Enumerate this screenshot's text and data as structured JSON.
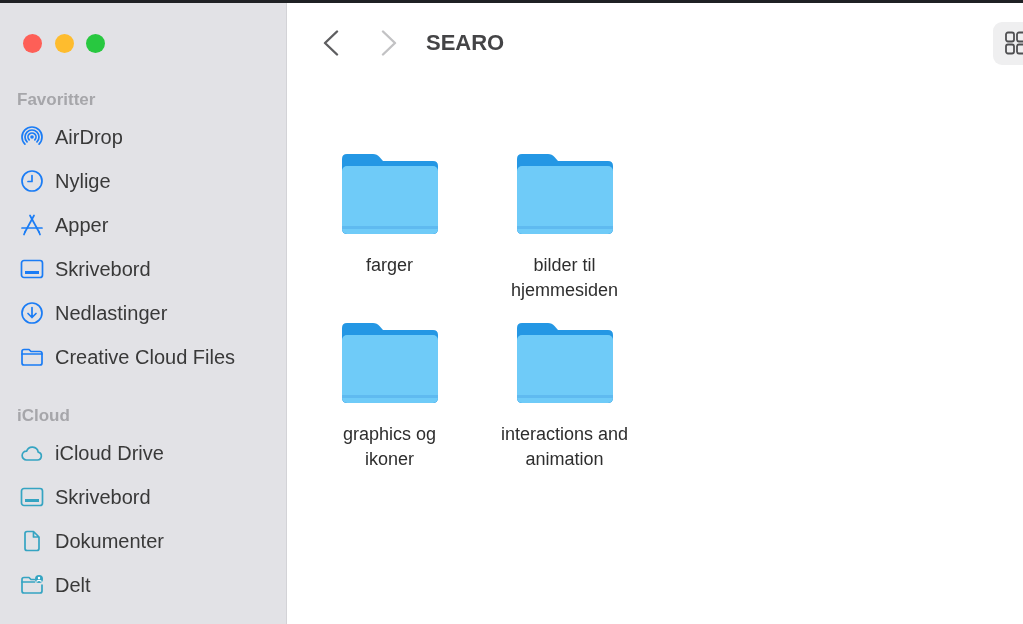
{
  "sidebar": {
    "sections": [
      {
        "title": "Favoritter",
        "items": [
          {
            "label": "AirDrop",
            "kind": "airdrop",
            "selected": false
          },
          {
            "label": "Nylige",
            "kind": "clock",
            "selected": false
          },
          {
            "label": "Apper",
            "kind": "apps",
            "selected": false
          },
          {
            "label": "Skrivebord",
            "kind": "desktop",
            "selected": false
          },
          {
            "label": "Nedlastinger",
            "kind": "download",
            "selected": false
          },
          {
            "label": "Creative Cloud Files",
            "kind": "folder",
            "selected": false
          }
        ]
      },
      {
        "title": "iCloud",
        "items": [
          {
            "label": "iCloud Drive",
            "kind": "cloud",
            "selected": false
          },
          {
            "label": "Skrivebord",
            "kind": "desktop",
            "selected": false
          },
          {
            "label": "Dokumenter",
            "kind": "document",
            "selected": false
          },
          {
            "label": "Delt",
            "kind": "shared",
            "selected": false
          }
        ]
      }
    ]
  },
  "toolbar": {
    "navigation": [
      {
        "kind": "back",
        "disabled": false
      },
      {
        "kind": "forward",
        "disabled": true
      }
    ],
    "title": "SEARO"
  },
  "folders": [
    {
      "name": "farger",
      "selected": false
    },
    {
      "name": "bilder til hjemmesiden",
      "selected": false
    },
    {
      "name": "graphics og ikoner",
      "selected": false
    },
    {
      "name": "interactions and animation",
      "selected": false
    }
  ]
}
